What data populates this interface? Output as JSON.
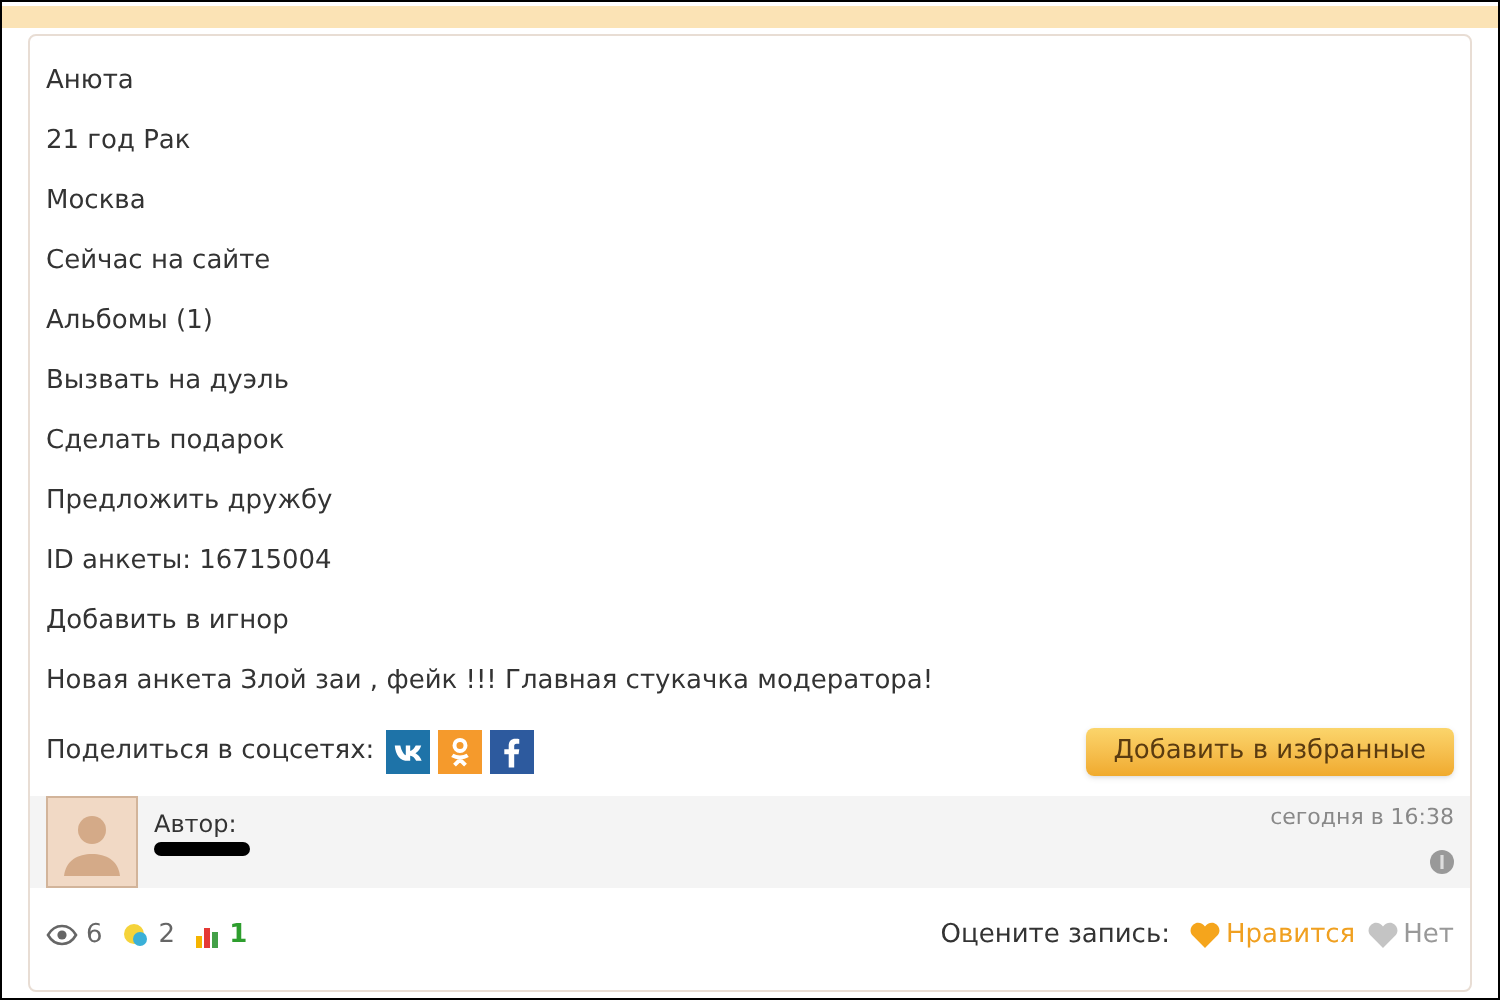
{
  "profile_lines": [
    "Анюта",
    "21 год Рак",
    "Москва",
    "Сейчас на сайте",
    "Альбомы (1)",
    "Вызвать на дуэль",
    "Сделать подарок",
    "Предложить дружбу",
    "ID анкеты: 16715004",
    "Добавить в игнор",
    "Новая анкета Злой заи , фейк !!! Главная стукачка модератора!"
  ],
  "share": {
    "label": "Поделиться в соцсетях:",
    "networks": [
      {
        "kind": "vk",
        "color": "#1e73a8"
      },
      {
        "kind": "ok",
        "color": "#f59a2c"
      },
      {
        "kind": "fb",
        "color": "#2d5a9e"
      }
    ]
  },
  "favorite_button": "Добавить в избранные",
  "author": {
    "label": "Автор:",
    "date": "сегодня в 16:38"
  },
  "stats": [
    {
      "kind": "views",
      "count": "6"
    },
    {
      "kind": "comments",
      "count": "2"
    },
    {
      "kind": "rating",
      "count": "1"
    }
  ],
  "rate": {
    "label": "Оцените запись:",
    "options": [
      {
        "label": "Нравится",
        "selected": true
      },
      {
        "label": "Нет",
        "selected": false
      }
    ]
  }
}
